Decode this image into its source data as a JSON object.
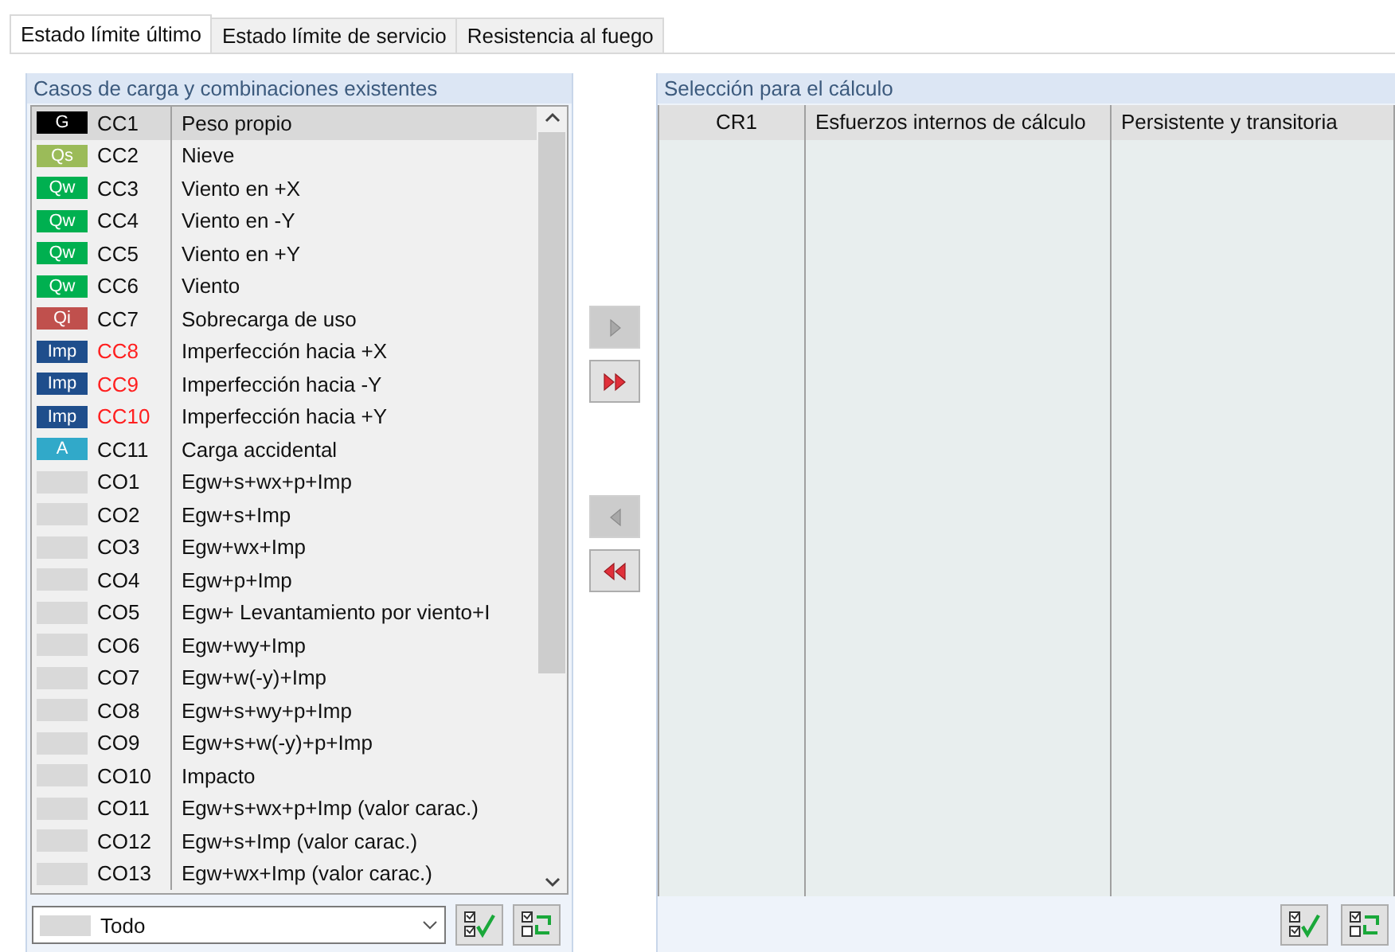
{
  "tabs": [
    {
      "label": "Estado límite último",
      "selected": true
    },
    {
      "label": "Estado límite de servicio",
      "selected": false
    },
    {
      "label": "Resistencia al fuego",
      "selected": false
    }
  ],
  "existing": {
    "title": "Casos de carga y combinaciones existentes",
    "rows": [
      {
        "tag": "G",
        "color": "#000000",
        "id": "CC1",
        "name": "Peso propio",
        "selected": true,
        "flagged": false
      },
      {
        "tag": "Qs",
        "color": "#9bbb59",
        "id": "CC2",
        "name": "Nieve",
        "selected": false,
        "flagged": false
      },
      {
        "tag": "Qw",
        "color": "#00b050",
        "id": "CC3",
        "name": "Viento en +X",
        "selected": false,
        "flagged": false
      },
      {
        "tag": "Qw",
        "color": "#00b050",
        "id": "CC4",
        "name": "Viento en -Y",
        "selected": false,
        "flagged": false
      },
      {
        "tag": "Qw",
        "color": "#00b050",
        "id": "CC5",
        "name": "Viento en +Y",
        "selected": false,
        "flagged": false
      },
      {
        "tag": "Qw",
        "color": "#00b050",
        "id": "CC6",
        "name": "Viento",
        "selected": false,
        "flagged": false
      },
      {
        "tag": "Qi",
        "color": "#c0504d",
        "id": "CC7",
        "name": "Sobrecarga de uso",
        "selected": false,
        "flagged": false
      },
      {
        "tag": "Imp",
        "color": "#1f4e8c",
        "id": "CC8",
        "name": "Imperfección hacia +X",
        "selected": false,
        "flagged": true
      },
      {
        "tag": "Imp",
        "color": "#1f4e8c",
        "id": "CC9",
        "name": "Imperfección hacia -Y",
        "selected": false,
        "flagged": true
      },
      {
        "tag": "Imp",
        "color": "#1f4e8c",
        "id": "CC10",
        "name": "Imperfección hacia +Y",
        "selected": false,
        "flagged": true
      },
      {
        "tag": "A",
        "color": "#31a9c9",
        "id": "CC11",
        "name": "Carga accidental",
        "selected": false,
        "flagged": false
      },
      {
        "color": "#d9d9d9",
        "id": "CO1",
        "name": "Egw+s+wx+p+Imp",
        "selected": false,
        "flagged": false
      },
      {
        "color": "#d9d9d9",
        "id": "CO2",
        "name": "Egw+s+Imp",
        "selected": false,
        "flagged": false
      },
      {
        "color": "#d9d9d9",
        "id": "CO3",
        "name": "Egw+wx+Imp",
        "selected": false,
        "flagged": false
      },
      {
        "color": "#d9d9d9",
        "id": "CO4",
        "name": "Egw+p+Imp",
        "selected": false,
        "flagged": false
      },
      {
        "color": "#d9d9d9",
        "id": "CO5",
        "name": "Egw+ Levantamiento por viento+I",
        "selected": false,
        "flagged": false
      },
      {
        "color": "#d9d9d9",
        "id": "CO6",
        "name": "Egw+wy+Imp",
        "selected": false,
        "flagged": false
      },
      {
        "color": "#d9d9d9",
        "id": "CO7",
        "name": "Egw+w(-y)+Imp",
        "selected": false,
        "flagged": false
      },
      {
        "color": "#d9d9d9",
        "id": "CO8",
        "name": "Egw+s+wy+p+Imp",
        "selected": false,
        "flagged": false
      },
      {
        "color": "#d9d9d9",
        "id": "CO9",
        "name": "Egw+s+w(-y)+p+Imp",
        "selected": false,
        "flagged": false
      },
      {
        "color": "#d9d9d9",
        "id": "CO10",
        "name": "Impacto",
        "selected": false,
        "flagged": false
      },
      {
        "color": "#d9d9d9",
        "id": "CO11",
        "name": "Egw+s+wx+p+Imp (valor carac.)",
        "selected": false,
        "flagged": false
      },
      {
        "color": "#d9d9d9",
        "id": "CO12",
        "name": "Egw+s+Imp (valor carac.)",
        "selected": false,
        "flagged": false
      },
      {
        "color": "#d9d9d9",
        "id": "CO13",
        "name": "Egw+wx+Imp (valor carac.)",
        "selected": false,
        "flagged": false
      }
    ],
    "filter": {
      "value": "Todo",
      "color": "#d9d9d9"
    }
  },
  "transfer": [
    {
      "kind": "add",
      "disabled": true
    },
    {
      "kind": "addall",
      "disabled": false
    },
    {
      "kind": "remove",
      "disabled": true
    },
    {
      "kind": "removeall",
      "disabled": false
    }
  ],
  "selection": {
    "title": "Selección para el cálculo",
    "columns": [
      "CR1",
      "Esfuerzos internos de cálculo",
      "Persistente y transitoria"
    ]
  }
}
